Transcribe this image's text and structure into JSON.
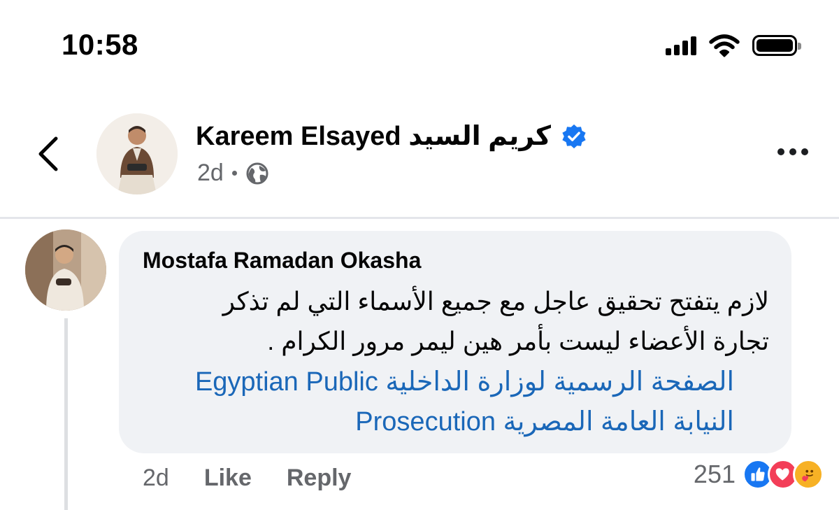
{
  "status_bar": {
    "time": "10:58"
  },
  "post_header": {
    "author_name": "Kareem Elsayed كريم السيد",
    "post_age": "2d",
    "audience_icon": "globe-icon",
    "verified_icon": "verified-badge-icon"
  },
  "comment": {
    "author": "Mostafa Ramadan Okasha",
    "text_lines": [
      "لازم يتفتح تحقيق عاجل مع جميع الأسماء التي لم تذكر",
      "تجارة الأعضاء ليست بأمر هين ليمر مرور الكرام ."
    ],
    "tags_lines": [
      "الصفحة الرسمية لوزارة الداخلية Egyptian Public",
      "النيابة العامة المصرية Prosecution"
    ],
    "age": "2d",
    "like_label": "Like",
    "reply_label": "Reply",
    "reaction_count": "251",
    "reaction_icons": [
      "like-icon",
      "love-icon",
      "care-icon"
    ]
  },
  "colors": {
    "link": "#1a67b8",
    "bubble": "#f0f2f5",
    "meta_text": "#65676b",
    "verified": "#1877f2"
  }
}
